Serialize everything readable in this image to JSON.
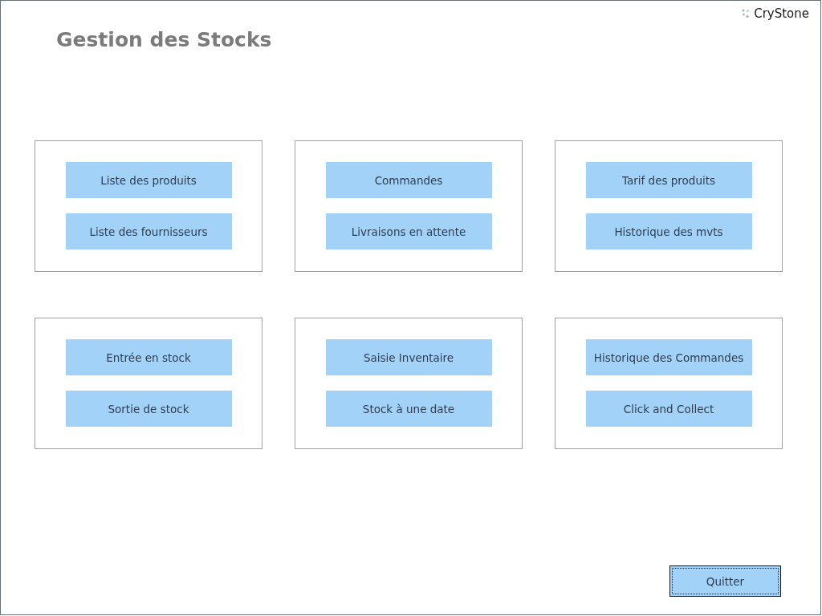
{
  "header": {
    "title": "Gestion des Stocks",
    "brand": "CryStone"
  },
  "panels": [
    {
      "buttons": [
        {
          "label": "Liste des produits"
        },
        {
          "label": "Liste des fournisseurs"
        }
      ]
    },
    {
      "buttons": [
        {
          "label": "Commandes"
        },
        {
          "label": "Livraisons en attente"
        }
      ]
    },
    {
      "buttons": [
        {
          "label": "Tarif des produits"
        },
        {
          "label": "Historique des mvts"
        }
      ]
    },
    {
      "buttons": [
        {
          "label": "Entrée en stock"
        },
        {
          "label": "Sortie de stock"
        }
      ]
    },
    {
      "buttons": [
        {
          "label": "Saisie Inventaire"
        },
        {
          "label": "Stock à une date"
        }
      ]
    },
    {
      "buttons": [
        {
          "label": "Historique des Commandes"
        },
        {
          "label": "Click and Collect"
        }
      ]
    }
  ],
  "quit_button": {
    "label": "Quitter",
    "focused": true
  }
}
